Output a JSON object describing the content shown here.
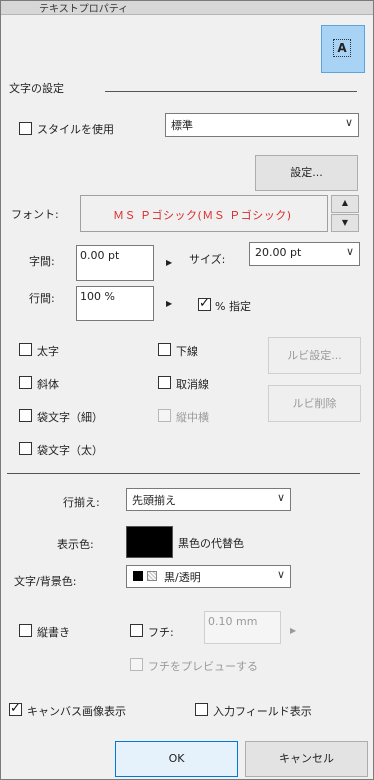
{
  "window": {
    "title": "テキストプロパティ"
  },
  "section": {
    "char_settings": "文字の設定"
  },
  "style": {
    "use_label": "スタイルを使用",
    "select_value": "標準"
  },
  "buttons": {
    "settings": "設定...",
    "ruby_settings": "ルビ設定...",
    "ruby_delete": "ルビ削除",
    "ok": "OK",
    "cancel": "キャンセル"
  },
  "font": {
    "label": "フォント:",
    "value": "ＭＳ Ｐゴシック(ＭＳ Ｐゴシック)",
    "color": "#d92b2b"
  },
  "spacing": {
    "char_label": "字間:",
    "char_value": "0.00 pt",
    "line_label": "行間:",
    "line_value": "100 %",
    "size_label": "サイズ:",
    "size_value": "20.00 pt",
    "percent_label": "% 指定"
  },
  "styles": {
    "bold": "太字",
    "italic": "斜体",
    "outline_thin": "袋文字（細）",
    "outline_thick": "袋文字（太）",
    "underline": "下線",
    "strike": "取消線",
    "tate_chu_yoko": "縦中横"
  },
  "align": {
    "label": "行揃え:",
    "value": "先頭揃え"
  },
  "color": {
    "label": "表示色:",
    "substitute": "黒色の代替色",
    "swatch": "#000000"
  },
  "bg": {
    "label": "文字/背景色:",
    "value": "黒/透明"
  },
  "vertical": {
    "label": "縦書き"
  },
  "border": {
    "label": "フチ:",
    "value": "0.10 mm",
    "preview": "フチをプレビューする"
  },
  "canvas": {
    "image_display": "キャンバス画像表示",
    "input_field_display": "入力フィールド表示"
  }
}
